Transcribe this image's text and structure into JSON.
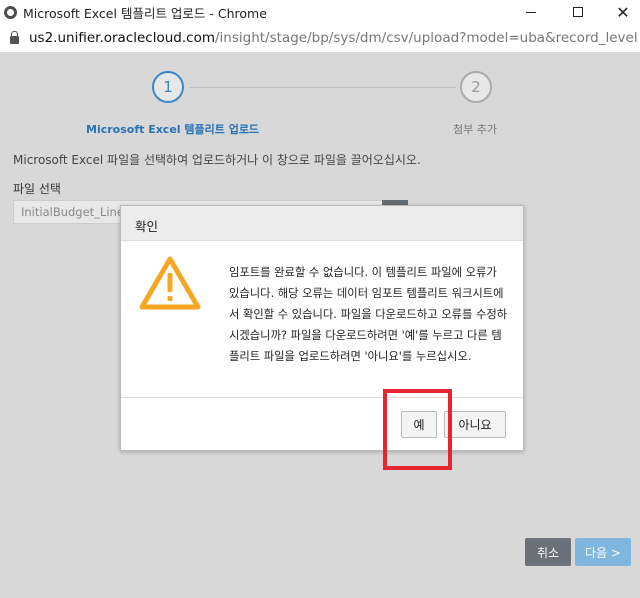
{
  "window": {
    "title": "Microsoft Excel 템플리트 업로드 - Chrome"
  },
  "address": {
    "host": "us2.unifier.oraclecloud.com",
    "path": "/insight/stage/bp/sys/dm/csv/upload?model=uba&record_level=t..."
  },
  "wizard": {
    "step1_number": "1",
    "step1_label": "Microsoft Excel 템플리트 업로드",
    "step2_number": "2",
    "step2_label": "첨부 추가"
  },
  "form": {
    "instruction": "Microsoft Excel 파일을 선택하여 업로드하거나 이 창으로 파일을 끌어오십시오.",
    "file_label": "파일 선택",
    "file_value": "InitialBudget_LineI"
  },
  "footer": {
    "cancel_label": "취소",
    "next_label": "다음 >"
  },
  "dialog": {
    "title": "확인",
    "message": "임포트를 완료할 수 없습니다. 이 템플리트 파일에 오류가 있습니다. 해당 오류는 데이터 임포트 템플리트 워크시트에서 확인할 수 있습니다. 파일을 다운로드하고 오류를 수정하시겠습니까? 파일을 다운로드하려면 '예'를 누르고 다른 템플리트 파일을 업로드하려면 '아니요'를 누르십시오.",
    "yes_label": "예",
    "no_label": "아니요",
    "icon": "warning-triangle-icon"
  },
  "colors": {
    "accent": "#3a87c8",
    "warning": "#f5a623",
    "highlight": "#e8242e"
  }
}
